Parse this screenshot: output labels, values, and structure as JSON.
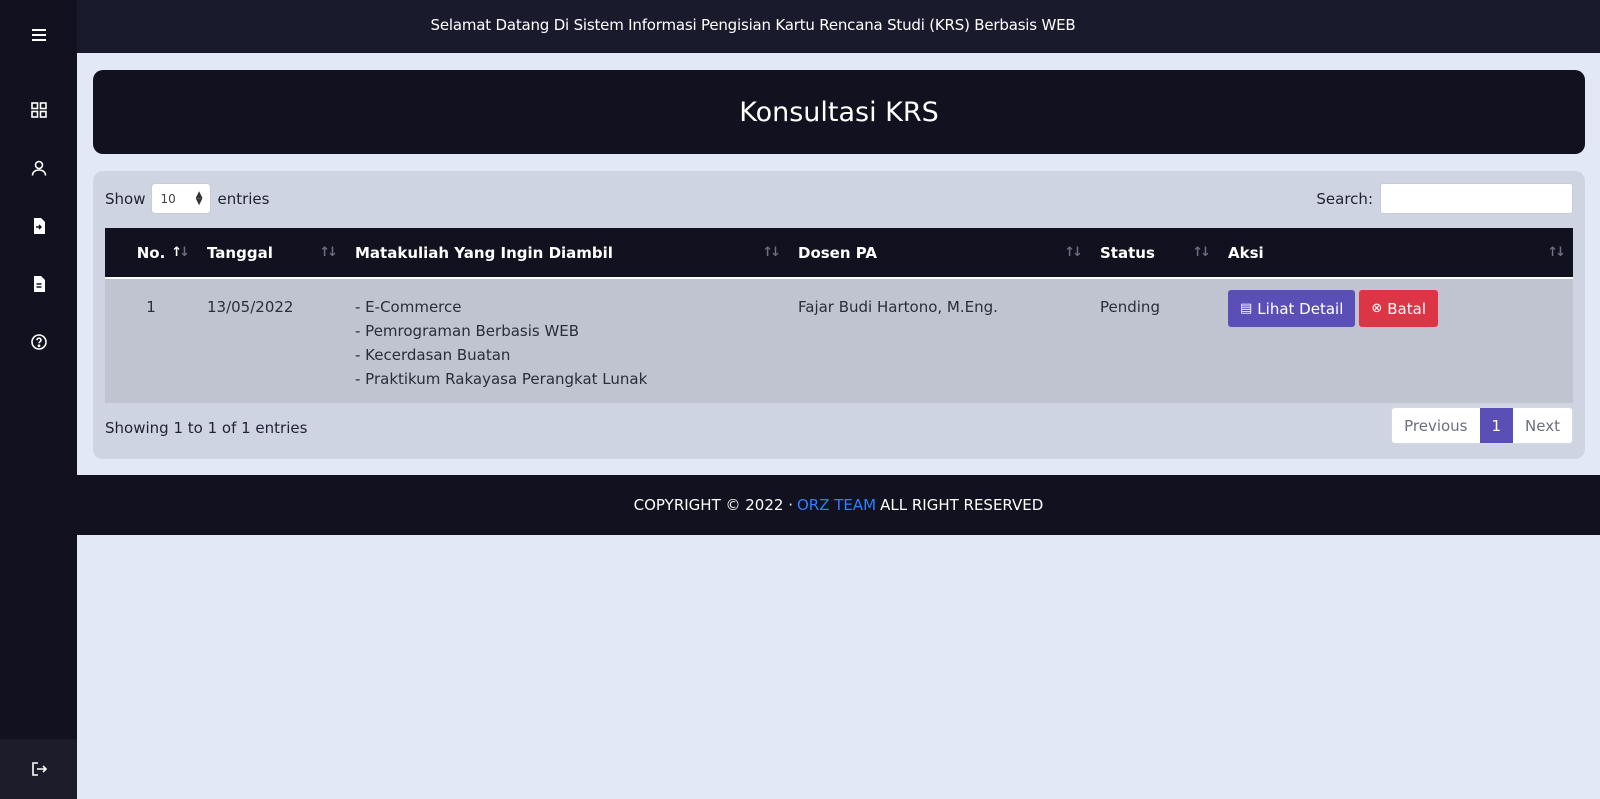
{
  "topbar": {
    "title": "Selamat Datang Di Sistem Informasi Pengisian Kartu Rencana Studi (KRS) Berbasis WEB"
  },
  "sidebar": {
    "items": [
      {
        "icon": "menu-icon"
      },
      {
        "icon": "dashboard-icon"
      },
      {
        "icon": "user-icon"
      },
      {
        "icon": "file-import-icon"
      },
      {
        "icon": "document-icon"
      },
      {
        "icon": "help-icon"
      }
    ],
    "logout_icon": "logout-icon"
  },
  "page": {
    "title": "Konsultasi KRS"
  },
  "table_controls": {
    "show_label": "Show",
    "entries_value": "10",
    "entries_label": "entries",
    "search_label": "Search:",
    "search_value": ""
  },
  "table": {
    "columns": [
      "No.",
      "Tanggal",
      "Matakuliah Yang Ingin Diambil",
      "Dosen PA",
      "Status",
      "Aksi"
    ],
    "rows": [
      {
        "no": "1",
        "tanggal": "13/05/2022",
        "matakuliah": [
          "- E-Commerce",
          "- Pemrograman Berbasis WEB",
          "- Kecerdasan Buatan",
          "- Praktikum Rakayasa Perangkat Lunak"
        ],
        "dosen": "Fajar Budi Hartono, M.Eng.",
        "status": "Pending",
        "detail_label": "Lihat Detail",
        "batal_label": "Batal"
      }
    ]
  },
  "pagination": {
    "info": "Showing 1 to 1 of 1 entries",
    "previous": "Previous",
    "current": "1",
    "next": "Next"
  },
  "footer": {
    "prefix": "COPYRIGHT © 2022 ·",
    "team": "ORZ TEAM",
    "suffix": "ALL RIGHT RESERVED"
  },
  "colors": {
    "sidebar": "#11111f",
    "accent": "#5a4fb6",
    "danger": "#dc3545",
    "link": "#2f7fff",
    "background": "#e3e8f6"
  }
}
